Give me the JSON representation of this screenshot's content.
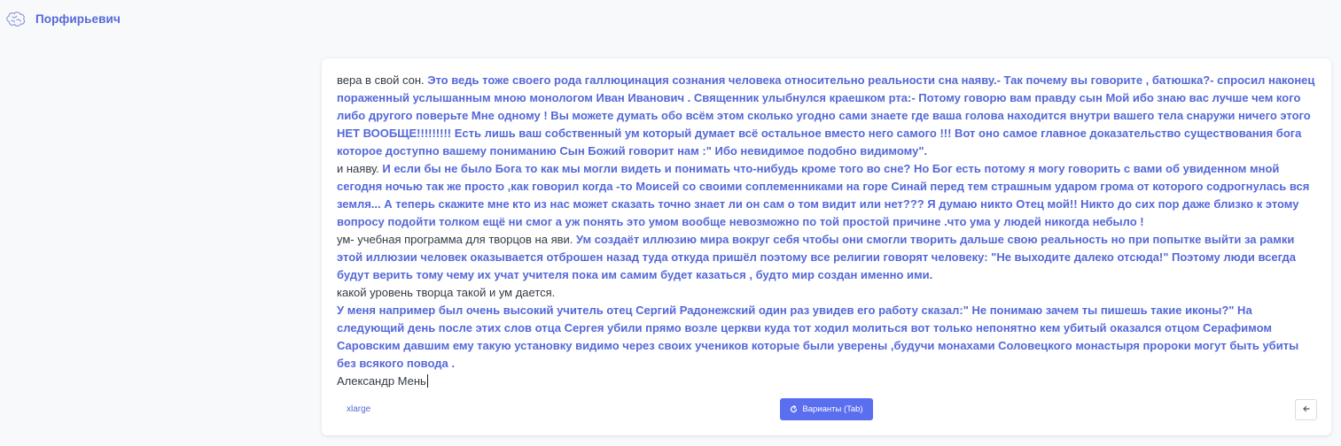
{
  "app": {
    "title": "Порфирьевич"
  },
  "editor": {
    "paragraphs": [
      {
        "user": "вера в свой сон. ",
        "generated": "Это ведь тоже своего рода галлюцинация сознания человека относительно реальности сна наяву.- Так почему вы говорите , батюшка?- спросил наконец пораженный услышанным мною монологом Иван Иванович . Священник улыбнулся краешком рта:- Потому говорю вам правду сын Мой ибо знаю вас лучше чем кого либо другого поверьте Мне одному ! Вы можете думать обо всём этом сколько угодно сами знаете где ваша голова находится внутри вашего тела снаружи ничего этого НЕТ ВООБЩЕ!!!!!!!!! Есть лишь ваш собственный ум который думает всё остальное вместо него самого !!! Вот оно самое главное доказательство существования бога которое доступно вашему пониманию Сын Божий говорит нам :\" Ибо невидимое подобно видимому\"."
      },
      {
        "user": "и наяву. ",
        "generated": "И если бы не было Бога то как мы могли видеть и понимать что-нибудь кроме того во сне? Но Бог есть потому я могу говорить с вами об увиденном мной сегодня ночью так же просто ,как говорил когда -то Моисей со своими соплеменниками на горе Синай перед тем страшным ударом грома от которого содрогнулась вся земля... А теперь скажите мне кто из нас может сказать точно знает ли он сам о том видит или нет??? Я думаю никто Отец мой!! Никто до сих пор даже близко к этому вопросу подойти толком ещё ни смог а уж понять это умом вообще невозможно по той простой причине .что ума у людей никогда небыло !"
      },
      {
        "user": "ум- учебная программа для творцов на яви. ",
        "generated": "Ум создаёт иллюзию мира вокруг себя чтобы они смогли творить дальше свою реальность но при попытке выйти за рамки этой иллюзии человек оказывается отброшен назад туда откуда пришёл поэтому все религии говорят человеку: \"Не выходите далеко отсюда!\" Поэтому люди всегда будут верить тому чему их учат учителя пока им самим будет казаться , будто мир создан именно ими."
      },
      {
        "user": "какой уровень творца такой и ум дается.",
        "generated": ""
      },
      {
        "user": "",
        "generated": " У меня например был очень высокий учитель отец Сергий Радонежский один раз увидев его работу сказал:\" Не понимаю зачем ты пишешь такие иконы?\" На следующий день после этих слов отца Сергея убили прямо возле церкви куда тот ходил молиться вот только непонятно кем убитый оказался отцом Серафимом Саровским давшим ему такую установку видимо через своих учеников которые были уверены ,будучи монахами Соловецкого монастыря пророки могут быть убиты без всякого повода ."
      },
      {
        "user": "Александр Мень",
        "generated": ""
      }
    ]
  },
  "footer": {
    "model_label": "xlarge",
    "variants_label": "Варианты (Tab)",
    "refresh_icon": "refresh-icon",
    "back_icon": "arrow-left-icon"
  },
  "colors": {
    "accent": "#5468d8",
    "button": "#5a6ff0",
    "text": "#333a44",
    "background": "#f8f9fb"
  }
}
